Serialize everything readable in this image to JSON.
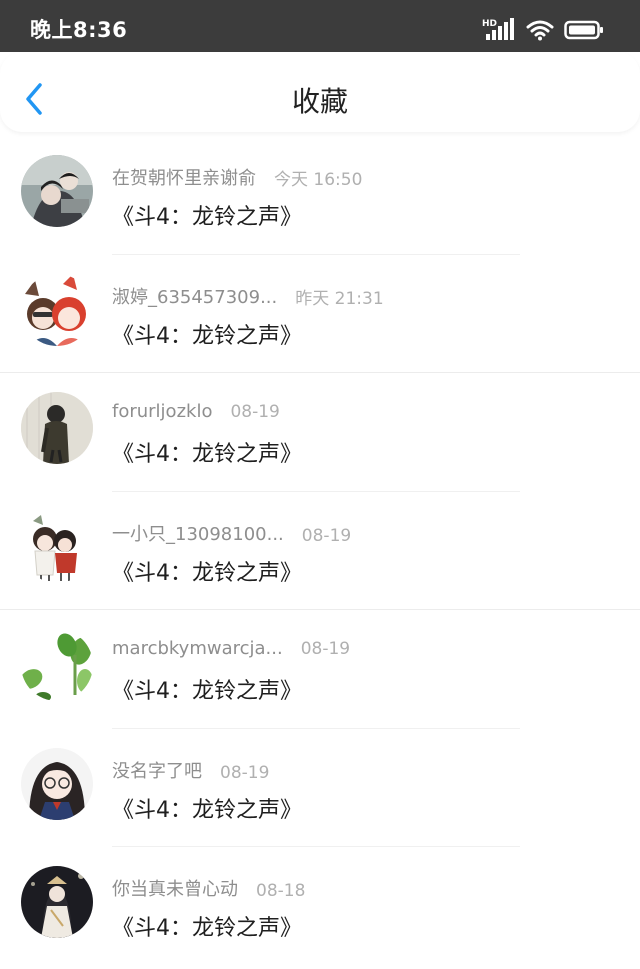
{
  "status_bar": {
    "time": "晚上8:36",
    "network_label": "HD",
    "icons": [
      "signal-icon",
      "wifi-icon",
      "battery-icon"
    ]
  },
  "header": {
    "title": "收藏",
    "back_icon": "chevron-left-icon",
    "accent_color": "#2196f3"
  },
  "favorites": [
    {
      "username": "在贺朝怀里亲谢俞",
      "time": "今天 16:50",
      "title": "《斗4：龙铃之声》"
    },
    {
      "username": "淑婷_635457309...",
      "time": "昨天 21:31",
      "title": "《斗4：龙铃之声》"
    },
    {
      "username": "forurljozklo",
      "time": "08-19",
      "title": "《斗4：龙铃之声》"
    },
    {
      "username": "一小只_13098100...",
      "time": "08-19",
      "title": "《斗4：龙铃之声》"
    },
    {
      "username": "marcbkymwarcja...",
      "time": "08-19",
      "title": "《斗4：龙铃之声》"
    },
    {
      "username": "没名字了吧",
      "time": "08-19",
      "title": "《斗4：龙铃之声》"
    },
    {
      "username": "你当真未曾心动",
      "time": "08-18",
      "title": "《斗4：龙铃之声》"
    }
  ]
}
